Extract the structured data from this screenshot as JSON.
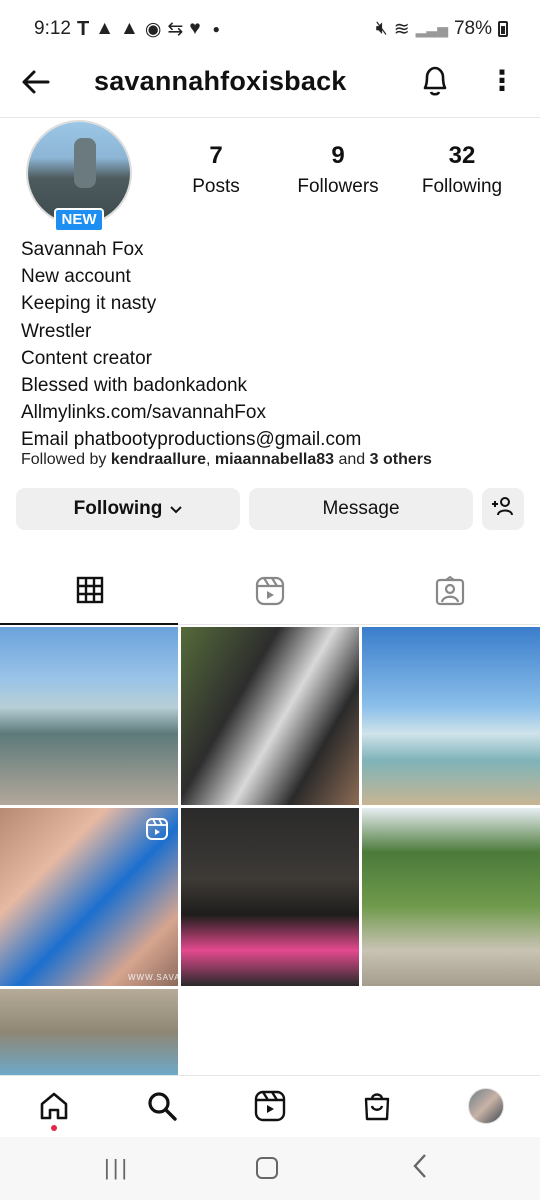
{
  "status_bar": {
    "time": "9:12",
    "left_icons": [
      "tmobile-icon",
      "alert-icon",
      "alert-icon",
      "app-icon",
      "sync-icon",
      "heart-icon"
    ],
    "battery": "78%"
  },
  "header": {
    "username": "savannahfoxisback"
  },
  "profile": {
    "badge": "NEW",
    "stats": {
      "posts": {
        "value": "7",
        "label": "Posts"
      },
      "followers": {
        "value": "9",
        "label": "Followers"
      },
      "following": {
        "value": "32",
        "label": "Following"
      }
    },
    "name": "Savannah Fox",
    "bio_lines": [
      "New account",
      "Keeping it nasty",
      "Wrestler",
      "Content creator",
      "Blessed with badonkadonk",
      "Allmylinks.com/savannahFox",
      "Email phatbootyproductions@gmail.com"
    ],
    "followed_by": {
      "prefix": "Followed by ",
      "user1": "kendraallure",
      "sep": ", ",
      "user2": "miaannabella83",
      "mid": " and ",
      "others": "3 others"
    }
  },
  "actions": {
    "following": "Following",
    "message": "Message"
  },
  "tabs": [
    "grid-icon",
    "reels-icon",
    "tagged-icon"
  ],
  "posts": [
    {
      "id": "post-1",
      "desc": ""
    },
    {
      "id": "post-2",
      "desc": ""
    },
    {
      "id": "post-3",
      "desc": ""
    },
    {
      "id": "post-4",
      "desc": "",
      "watermark": "WWW.SAVAN"
    },
    {
      "id": "post-5",
      "desc": ""
    },
    {
      "id": "post-6",
      "desc": ""
    },
    {
      "id": "post-7",
      "desc": ""
    }
  ],
  "bottom_nav": [
    "home-icon",
    "search-icon",
    "reels-icon",
    "shop-icon",
    "profile-avatar"
  ]
}
